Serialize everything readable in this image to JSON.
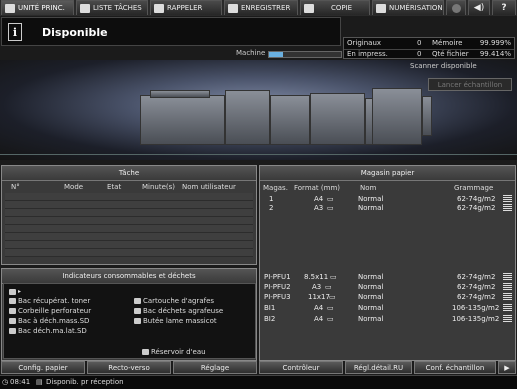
{
  "tabs": [
    {
      "label": "UNITÉ PRINC.",
      "icon": "printer-icon",
      "active": true
    },
    {
      "label": "LISTE TÂCHES",
      "icon": "list-icon",
      "active": false
    },
    {
      "label": "RAPPELER",
      "icon": "recall-icon",
      "active": false
    },
    {
      "label": "ENREGISTRER",
      "icon": "save-icon",
      "active": false
    },
    {
      "label": "COPIE",
      "icon": "copy-icon",
      "active": false
    },
    {
      "label": "NUMÉRISATION",
      "icon": "scan-icon",
      "active": false
    }
  ],
  "status": {
    "title": "Disponible",
    "icon": "info-icon"
  },
  "counters": {
    "originaux_label": "Originaux",
    "originaux_value": "0",
    "memoire_label": "Mémoire",
    "memoire_value": "99.999%",
    "impress_label": "En impress.",
    "impress_value": "0",
    "fichier_label": "Qté fichier",
    "fichier_value": "99.414%"
  },
  "machine": {
    "label": "Machine",
    "progress": 0.2
  },
  "scanner": {
    "label": "Scanner disponible",
    "sample_button": "Lancer échantillon"
  },
  "jobs": {
    "title": "Tâche",
    "columns": [
      "N°",
      "Mode",
      "Etat",
      "Minute(s)",
      "Nom utilisateur"
    ]
  },
  "consumables": {
    "title": "Indicateurs consommables et déchets",
    "items_left": [
      "Bac récupérat. toner",
      "Corbeille perforateur",
      "Bac à déch.mass.SD",
      "Bac déch.ma.lat.SD"
    ],
    "items_right": [
      "Cartouche d'agrafes",
      "Bac déchets agrafeuse",
      "Butée lame massicot"
    ],
    "water": "Réservoir d'eau"
  },
  "paper": {
    "title": "Magasin papier",
    "columns": [
      "Magas.",
      "Format (mm)",
      "Nom",
      "Grammage"
    ],
    "trays_top": [
      {
        "tray": "1",
        "format": "A4",
        "name": "Normal",
        "weight": "62-74g/m2"
      },
      {
        "tray": "2",
        "format": "A3",
        "name": "Normal",
        "weight": "62-74g/m2"
      }
    ],
    "trays_bottom": [
      {
        "tray": "PI-PFU1",
        "format": "8.5x11",
        "name": "Normal",
        "weight": "62-74g/m2"
      },
      {
        "tray": "PI-PFU2",
        "format": "A3",
        "name": "Normal",
        "weight": "62-74g/m2"
      },
      {
        "tray": "PI-PFU3",
        "format": "11x17",
        "name": "Normal",
        "weight": "62-74g/m2"
      },
      {
        "tray": "BI1",
        "format": "A4",
        "name": "Normal",
        "weight": "106-135g/m2"
      },
      {
        "tray": "BI2",
        "format": "A4",
        "name": "Normal",
        "weight": "106-135g/m2"
      }
    ]
  },
  "buttons": [
    "Config. papier",
    "Recto-verso",
    "Réglage",
    "Contrôleur",
    "Régl.détail.RU",
    "Conf. échantillon"
  ],
  "footer": {
    "time": "08:41",
    "status": "Disponib. pr réception"
  }
}
